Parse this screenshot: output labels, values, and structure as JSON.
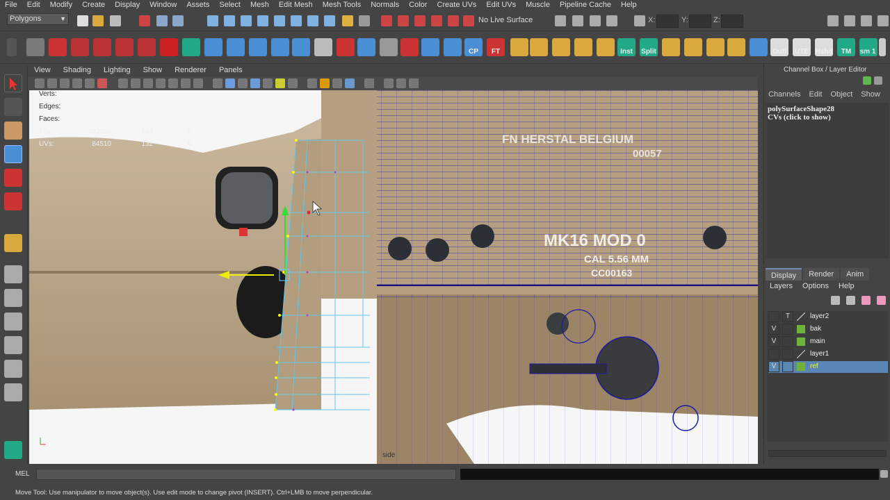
{
  "menubar": {
    "items": [
      "File",
      "Edit",
      "Modify",
      "Create",
      "Display",
      "Window",
      "Assets",
      "Select",
      "Mesh",
      "Edit Mesh",
      "Mesh Tools",
      "Normals",
      "Color",
      "Create UVs",
      "Edit UVs",
      "Muscle",
      "Pipeline Cache",
      "Help"
    ]
  },
  "status_line": {
    "mode": "Polygons",
    "live_surface": "No Live Surface",
    "coord_labels": [
      "X:",
      "Y:",
      "Z:"
    ]
  },
  "shelf": {
    "labels": [
      "CP",
      "FT",
      "Inst",
      "Split",
      "Outl",
      "UTE",
      "Hshd",
      "TM",
      "sm 1"
    ]
  },
  "panel": {
    "menu": [
      "View",
      "Shading",
      "Lighting",
      "Show",
      "Renderer",
      "Panels"
    ]
  },
  "hud": {
    "verts_label": "Verts:",
    "edges_label": "Edges:",
    "faces_label": "Faces:",
    "tris_label": "Tris:",
    "uvs_label": "UVs:",
    "tris": [
      "102360",
      "124",
      "0"
    ],
    "uvs": [
      "84510",
      "132",
      "0"
    ]
  },
  "viewport": {
    "camera": "side",
    "engraving": [
      "FN HERSTAL BELGIUM",
      "00057",
      "MK16 MOD 0",
      "CAL 5.56 MM",
      "CC00163"
    ]
  },
  "channel_box": {
    "title": "Channel Box / Layer Editor",
    "menu": [
      "Channels",
      "Edit",
      "Object",
      "Show"
    ],
    "shape": "polySurfaceShape28",
    "cvs": "CVs (click to show)"
  },
  "layer_editor": {
    "tabs": [
      "Display",
      "Render",
      "Anim"
    ],
    "menu": [
      "Layers",
      "Options",
      "Help"
    ],
    "layers": [
      {
        "v": "",
        "t": "T",
        "name": "layer2",
        "color": "",
        "selected": false
      },
      {
        "v": "V",
        "t": "",
        "name": "bak",
        "color": "#6fb23a",
        "selected": false
      },
      {
        "v": "V",
        "t": "",
        "name": "main",
        "color": "#6fb23a",
        "selected": false
      },
      {
        "v": "",
        "t": "",
        "name": "layer1",
        "color": "",
        "selected": false
      },
      {
        "v": "V",
        "t": "",
        "name": "ref",
        "color": "#6fb23a",
        "selected": true
      }
    ]
  },
  "command_line": {
    "label": "MEL"
  },
  "help_line": {
    "text": "Move Tool: Use manipulator to move object(s). Use edit mode to change pivot (INSERT).  Ctrl+LMB to move perpendicular."
  }
}
